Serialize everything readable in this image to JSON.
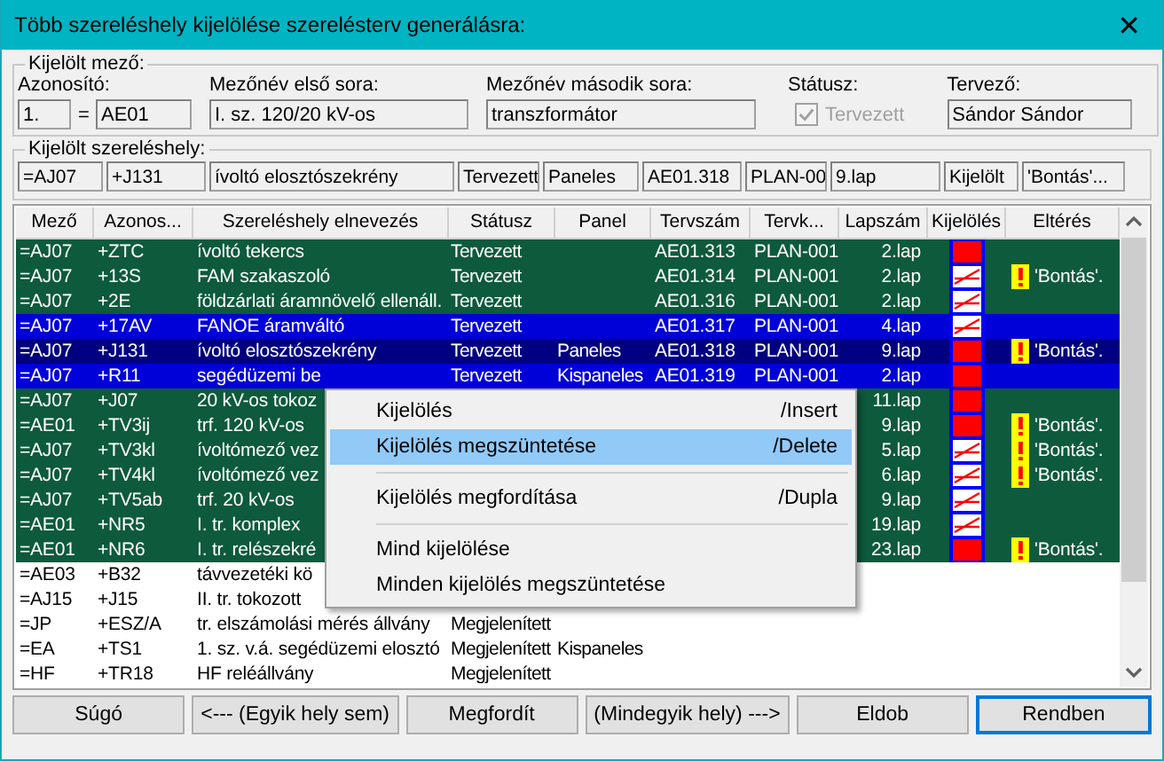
{
  "window": {
    "title": "Több szereléshely kijelölése szerelésterv generálásra:",
    "close": "✕"
  },
  "field_group": {
    "legend": "Kijelölt mező:",
    "id_label": "Azonosító:",
    "id_index": "1.",
    "equals": "=",
    "id_value": "AE01",
    "name1_label": "Mezőnév első sora:",
    "name1_value": "I. sz. 120/20 kV-os",
    "name2_label": "Mezőnév második sora:",
    "name2_value": "transzformátor",
    "status_label": "Státusz:",
    "status_checkbox": {
      "label": "Tervezett",
      "checked": true,
      "disabled": true
    },
    "designer_label": "Tervező:",
    "designer_value": "Sándor Sándor"
  },
  "location_group": {
    "legend": "Kijelölt szereléshely:",
    "values": [
      "=AJ07",
      "+J131",
      "ívoltó elosztószekrény",
      "Tervezett",
      "Paneles",
      "AE01.318",
      "PLAN-00",
      "9.lap",
      "Kijelölt",
      "'Bontás'..."
    ]
  },
  "table": {
    "columns": [
      "Mező",
      "Azonos...",
      "Szereléshely elnevezés",
      "Státusz",
      "Panel",
      "Tervszám",
      "Tervk...",
      "Lapszám",
      "Kijelölés",
      "Eltérés"
    ],
    "rows": [
      {
        "cells": [
          "=AJ07",
          "+ZTC",
          "ívoltó tekercs",
          "Tervezett",
          "",
          "AE01.313",
          "PLAN-001",
          "2.lap"
        ],
        "included": true,
        "selected": false,
        "focused": false,
        "marked": true,
        "deviation": ""
      },
      {
        "cells": [
          "=AJ07",
          "+13S",
          "FAM szakaszoló",
          "Tervezett",
          "",
          "AE01.314",
          "PLAN-001",
          "2.lap"
        ],
        "included": true,
        "selected": false,
        "focused": false,
        "marked": false,
        "deviation": "'Bontás'."
      },
      {
        "cells": [
          "=AJ07",
          "+2E",
          "földzárlati áramnövelő ellenáll.",
          "Tervezett",
          "",
          "AE01.316",
          "PLAN-001",
          "2.lap"
        ],
        "included": true,
        "selected": false,
        "focused": false,
        "marked": false,
        "deviation": ""
      },
      {
        "cells": [
          "=AJ07",
          "+17AV",
          "FANOE áramváltó",
          "Tervezett",
          "",
          "AE01.317",
          "PLAN-001",
          "4.lap"
        ],
        "included": true,
        "selected": true,
        "focused": false,
        "marked": false,
        "deviation": ""
      },
      {
        "cells": [
          "=AJ07",
          "+J131",
          "ívoltó elosztószekrény",
          "Tervezett",
          "Paneles",
          "AE01.318",
          "PLAN-001",
          "9.lap"
        ],
        "included": true,
        "selected": true,
        "focused": true,
        "marked": true,
        "deviation": "'Bontás'."
      },
      {
        "cells": [
          "=AJ07",
          "+R11",
          "segédüzemi be",
          "Tervezett",
          "Kispaneles",
          "AE01.319",
          "PLAN-001",
          "2.lap"
        ],
        "included": true,
        "selected": true,
        "focused": false,
        "marked": true,
        "deviation": ""
      },
      {
        "cells": [
          "=AJ07",
          "+J07",
          "20 kV-os tokoz",
          "",
          "",
          "",
          "",
          "11.lap"
        ],
        "included": true,
        "selected": false,
        "focused": false,
        "marked": true,
        "deviation": ""
      },
      {
        "cells": [
          "=AE01",
          "+TV3ij",
          "trf. 120 kV-os",
          "",
          "",
          "",
          "",
          "9.lap"
        ],
        "included": true,
        "selected": false,
        "focused": false,
        "marked": true,
        "deviation": "'Bontás'."
      },
      {
        "cells": [
          "=AJ07",
          "+TV3kl",
          "ívoltómező vez",
          "",
          "",
          "",
          "",
          "5.lap"
        ],
        "included": true,
        "selected": false,
        "focused": false,
        "marked": false,
        "deviation": "'Bontás'."
      },
      {
        "cells": [
          "=AJ07",
          "+TV4kl",
          "ívoltómező vez",
          "",
          "",
          "",
          "",
          "6.lap"
        ],
        "included": true,
        "selected": false,
        "focused": false,
        "marked": false,
        "deviation": "'Bontás'."
      },
      {
        "cells": [
          "=AJ07",
          "+TV5ab",
          "trf. 20 kV-os",
          "",
          "",
          "",
          "",
          "9.lap"
        ],
        "included": true,
        "selected": false,
        "focused": false,
        "marked": false,
        "deviation": ""
      },
      {
        "cells": [
          "=AE01",
          "+NR5",
          "I. tr. komplex",
          "",
          "",
          "",
          "",
          "19.lap"
        ],
        "included": true,
        "selected": false,
        "focused": false,
        "marked": false,
        "deviation": ""
      },
      {
        "cells": [
          "=AE01",
          "+NR6",
          "I. tr. relészekré",
          "",
          "",
          "",
          "",
          "23.lap"
        ],
        "included": true,
        "selected": false,
        "focused": false,
        "marked": true,
        "deviation": "'Bontás'."
      },
      {
        "cells": [
          "=AE03",
          "+B32",
          "távvezetéki kö",
          "",
          "",
          "",
          "",
          ""
        ],
        "included": false,
        "selected": false,
        "focused": false,
        "deviation": ""
      },
      {
        "cells": [
          "=AJ15",
          "+J15",
          "II. tr. tokozott",
          "",
          "",
          "",
          "",
          ""
        ],
        "included": false,
        "selected": false,
        "focused": false,
        "deviation": ""
      },
      {
        "cells": [
          "=JP",
          "+ESZ/A",
          "tr. elszámolási mérés állvány",
          "Megjelenített",
          "",
          "",
          "",
          ""
        ],
        "included": false,
        "selected": false,
        "focused": false,
        "deviation": ""
      },
      {
        "cells": [
          "=EA",
          "+TS1",
          "1. sz. v.á. segédüzemi elosztó",
          "Megjelenített",
          "Kispaneles",
          "",
          "",
          ""
        ],
        "included": false,
        "selected": false,
        "focused": false,
        "deviation": ""
      },
      {
        "cells": [
          "=HF",
          "+TR18",
          "HF reléállvány",
          "Megjelenített",
          "",
          "",
          "",
          ""
        ],
        "included": false,
        "selected": false,
        "focused": false,
        "deviation": ""
      }
    ]
  },
  "context_menu": [
    {
      "kind": "item",
      "label": "Kijelölés",
      "shortcut": "/Insert",
      "selected": false
    },
    {
      "kind": "item",
      "label": "Kijelölés megszüntetése",
      "shortcut": "/Delete",
      "selected": true
    },
    {
      "kind": "separator"
    },
    {
      "kind": "item",
      "label": "Kijelölés megfordítása",
      "shortcut": "/Dupla",
      "selected": false
    },
    {
      "kind": "separator"
    },
    {
      "kind": "item",
      "label": "Mind kijelölése",
      "selected": false
    },
    {
      "kind": "item",
      "label": "Minden kijelölés megszüntetése",
      "selected": false
    }
  ],
  "buttons": [
    {
      "label": "Súgó",
      "default": false
    },
    {
      "label": "<--- (Egyik hely sem)",
      "default": false
    },
    {
      "label": "Megfordít",
      "default": false
    },
    {
      "label": "(Mindegyik hely) --->",
      "default": false
    },
    {
      "label": "Eldob",
      "default": false
    },
    {
      "label": "Rendben",
      "default": true
    }
  ]
}
